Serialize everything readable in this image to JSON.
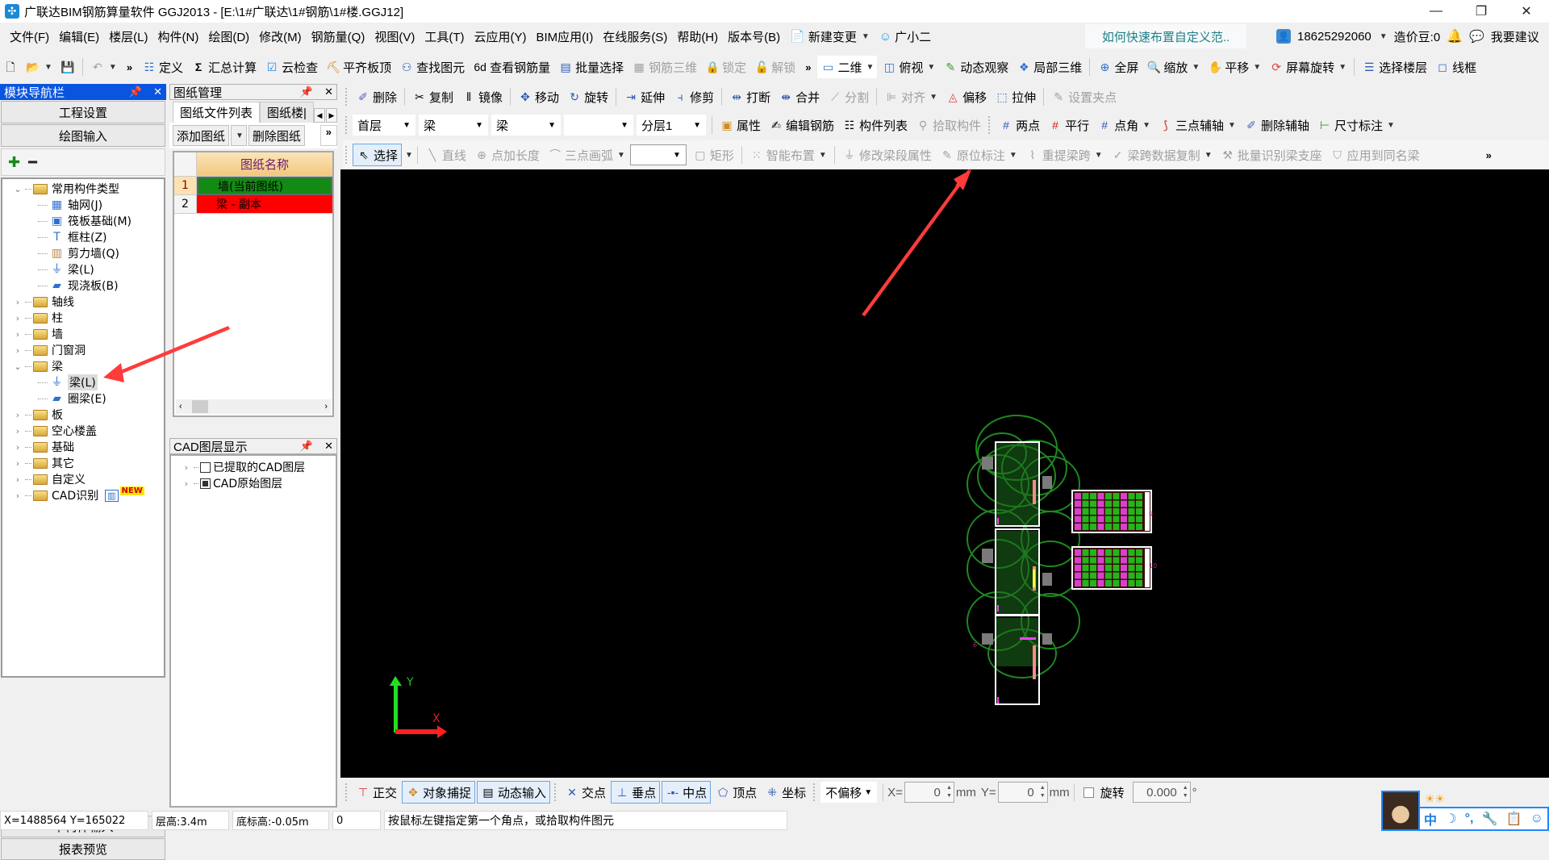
{
  "window": {
    "title": "广联达BIM钢筋算量软件 GGJ2013 - [E:\\1#广联达\\1#钢筋\\1#楼.GGJ12]",
    "controls": {
      "minimize": "—",
      "restore": "❐",
      "close": "✕"
    }
  },
  "menu": {
    "items": [
      "文件(F)",
      "编辑(E)",
      "楼层(L)",
      "构件(N)",
      "绘图(D)",
      "修改(M)",
      "钢筋量(Q)",
      "视图(V)",
      "工具(T)",
      "云应用(Y)",
      "BIM应用(I)",
      "在线服务(S)",
      "帮助(H)",
      "版本号(B)"
    ],
    "new_change": "新建变更",
    "assistant": "广小二",
    "tip": "如何快速布置自定义范..",
    "account": "18625292060",
    "beans": "造价豆:0",
    "suggest": "我要建议"
  },
  "toolbar1": {
    "items": [
      {
        "label": "定义",
        "icon": "define-icon",
        "disabled": false
      },
      {
        "label": "汇总计算",
        "icon": "sigma-icon",
        "disabled": false
      },
      {
        "label": "云检查",
        "icon": "cloud-check-icon",
        "disabled": false
      },
      {
        "label": "平齐板顶",
        "icon": "align-slab-top-icon",
        "disabled": false
      },
      {
        "label": "查找图元",
        "icon": "binoculars-icon",
        "disabled": false
      },
      {
        "label": "查看钢筋量",
        "icon": "view-rebar-icon",
        "disabled": false
      },
      {
        "label": "批量选择",
        "icon": "batch-select-icon",
        "disabled": false
      },
      {
        "label": "钢筋三维",
        "icon": "rebar-3d-icon",
        "disabled": true
      },
      {
        "label": "锁定",
        "icon": "lock-icon",
        "disabled": true
      },
      {
        "label": "解锁",
        "icon": "unlock-icon",
        "disabled": true
      }
    ],
    "view_items": [
      {
        "label": "二维",
        "icon": "2d-icon",
        "dropdown": true
      },
      {
        "label": "俯视",
        "icon": "top-view-icon",
        "dropdown": true
      },
      {
        "label": "动态观察",
        "icon": "orbit-icon",
        "dropdown": false
      },
      {
        "label": "局部三维",
        "icon": "local-3d-icon",
        "dropdown": false
      },
      {
        "label": "全屏",
        "icon": "fullscreen-icon",
        "dropdown": false
      },
      {
        "label": "缩放",
        "icon": "zoom-icon",
        "dropdown": true
      },
      {
        "label": "平移",
        "icon": "pan-icon",
        "dropdown": true
      },
      {
        "label": "屏幕旋转",
        "icon": "screen-rotate-icon",
        "dropdown": true
      },
      {
        "label": "选择楼层",
        "icon": "select-floor-icon",
        "dropdown": false
      },
      {
        "label": "线框",
        "icon": "wireframe-icon",
        "dropdown": false
      }
    ]
  },
  "toolbar2": {
    "items": [
      {
        "label": "删除",
        "icon": "delete-icon",
        "disabled": false
      },
      {
        "label": "复制",
        "icon": "copy-icon",
        "disabled": false
      },
      {
        "label": "镜像",
        "icon": "mirror-icon",
        "disabled": false
      },
      {
        "label": "移动",
        "icon": "move-icon",
        "disabled": false
      },
      {
        "label": "旋转",
        "icon": "rotate-icon",
        "disabled": false
      },
      {
        "label": "延伸",
        "icon": "extend-icon",
        "disabled": false
      },
      {
        "label": "修剪",
        "icon": "trim-icon",
        "disabled": false
      },
      {
        "label": "打断",
        "icon": "break-icon",
        "disabled": false
      },
      {
        "label": "合并",
        "icon": "merge-icon",
        "disabled": false
      },
      {
        "label": "分割",
        "icon": "split-icon",
        "disabled": true
      },
      {
        "label": "对齐",
        "icon": "align-icon",
        "disabled": true
      },
      {
        "label": "偏移",
        "icon": "offset-icon",
        "disabled": false
      },
      {
        "label": "拉伸",
        "icon": "stretch-icon",
        "disabled": false
      },
      {
        "label": "设置夹点",
        "icon": "grip-point-icon",
        "disabled": true
      }
    ]
  },
  "toolbar3": {
    "floor": "首层",
    "type": "梁",
    "subtype": "梁",
    "component": "",
    "layer": "分层1",
    "items": [
      {
        "label": "属性",
        "icon": "properties-icon",
        "disabled": false
      },
      {
        "label": "编辑钢筋",
        "icon": "edit-rebar-icon",
        "disabled": false
      },
      {
        "label": "构件列表",
        "icon": "component-list-icon",
        "disabled": false
      },
      {
        "label": "拾取构件",
        "icon": "pick-component-icon",
        "disabled": true
      }
    ],
    "axis_items": [
      {
        "label": "两点",
        "icon": "two-point-axis-icon",
        "dropdown": false
      },
      {
        "label": "平行",
        "icon": "parallel-axis-icon",
        "dropdown": false
      },
      {
        "label": "点角",
        "icon": "point-angle-axis-icon",
        "dropdown": true
      },
      {
        "label": "三点辅轴",
        "icon": "three-point-axis-icon",
        "dropdown": true
      },
      {
        "label": "删除辅轴",
        "icon": "delete-axis-icon",
        "dropdown": false
      },
      {
        "label": "尺寸标注",
        "icon": "dimension-icon",
        "dropdown": true
      }
    ]
  },
  "toolbar4": {
    "select": "选择",
    "items": [
      {
        "label": "直线",
        "icon": "line-icon",
        "disabled": true
      },
      {
        "label": "点加长度",
        "icon": "point-length-icon",
        "disabled": true
      },
      {
        "label": "三点画弧",
        "icon": "arc-icon",
        "disabled": true
      }
    ],
    "arc_combo": "",
    "rect": "矩形",
    "more_items": [
      {
        "label": "智能布置",
        "icon": "smart-place-icon",
        "dropdown": true
      },
      {
        "label": "修改梁段属性",
        "icon": "beam-segment-icon",
        "dropdown": false
      },
      {
        "label": "原位标注",
        "icon": "in-situ-label-icon",
        "dropdown": true
      },
      {
        "label": "重提梁跨",
        "icon": "re-extract-span-icon",
        "dropdown": true
      },
      {
        "label": "梁跨数据复制",
        "icon": "span-copy-icon",
        "dropdown": true
      },
      {
        "label": "批量识别梁支座",
        "icon": "batch-support-icon",
        "dropdown": false
      },
      {
        "label": "应用到同名梁",
        "icon": "apply-same-beam-icon",
        "dropdown": false
      }
    ]
  },
  "leftnav": {
    "title": "模块导航栏",
    "top_buttons": [
      "工程设置",
      "绘图输入"
    ],
    "tree": [
      {
        "label": "常用构件类型",
        "expanded": true,
        "children": [
          {
            "label": "轴网(J)",
            "icon": "grid-icon"
          },
          {
            "label": "筏板基础(M)",
            "icon": "raft-foundation-icon"
          },
          {
            "label": "框柱(Z)",
            "icon": "frame-column-icon"
          },
          {
            "label": "剪力墙(Q)",
            "icon": "shear-wall-icon"
          },
          {
            "label": "梁(L)",
            "icon": "beam-icon"
          },
          {
            "label": "现浇板(B)",
            "icon": "slab-icon"
          }
        ]
      },
      {
        "label": "轴线",
        "expanded": false
      },
      {
        "label": "柱",
        "expanded": false
      },
      {
        "label": "墙",
        "expanded": false
      },
      {
        "label": "门窗洞",
        "expanded": false
      },
      {
        "label": "梁",
        "expanded": true,
        "children": [
          {
            "label": "梁(L)",
            "icon": "beam-icon",
            "selected": true
          },
          {
            "label": "圈梁(E)",
            "icon": "ring-beam-icon"
          }
        ]
      },
      {
        "label": "板",
        "expanded": false
      },
      {
        "label": "空心楼盖",
        "expanded": false
      },
      {
        "label": "基础",
        "expanded": false
      },
      {
        "label": "其它",
        "expanded": false
      },
      {
        "label": "自定义",
        "expanded": false
      },
      {
        "label": "CAD识别",
        "expanded": false,
        "badge": "NEW"
      }
    ],
    "bottom_buttons": [
      "单构件输入",
      "报表预览"
    ]
  },
  "drawing_manager": {
    "title": "图纸管理",
    "tabs": [
      "图纸文件列表",
      "图纸楼|"
    ],
    "add_button": "添加图纸",
    "delete_button": "删除图纸",
    "column_header": "图纸名称",
    "rows": [
      {
        "num": "1",
        "name": "墙(当前图纸)",
        "color": "#138a13"
      },
      {
        "num": "2",
        "name": "梁 - 副本",
        "color": "#ff0000"
      }
    ]
  },
  "cad_layers": {
    "title": "CAD图层显示",
    "items": [
      {
        "label": "已提取的CAD图层",
        "checked": false
      },
      {
        "label": "CAD原始图层",
        "checked": true
      }
    ]
  },
  "canvas": {
    "background": "#000000",
    "axis_y": "Y",
    "axis_x": "X",
    "sheet_labels": [
      "9",
      "10",
      "6"
    ]
  },
  "snapbar": {
    "items": [
      {
        "label": "正交",
        "icon": "ortho-icon",
        "on": false
      },
      {
        "label": "对象捕捉",
        "icon": "object-snap-icon",
        "on": true
      },
      {
        "label": "动态输入",
        "icon": "dynamic-input-icon",
        "on": true
      },
      {
        "label": "交点",
        "icon": "intersection-icon",
        "on": false
      },
      {
        "label": "垂点",
        "icon": "perpendicular-icon",
        "on": true
      },
      {
        "label": "中点",
        "icon": "midpoint-icon",
        "on": true
      },
      {
        "label": "顶点",
        "icon": "vertex-icon",
        "on": false
      },
      {
        "label": "坐标",
        "icon": "coordinate-icon",
        "on": false
      }
    ],
    "offset_mode": "不偏移",
    "x_label": "X=",
    "x_value": "0",
    "y_label": "Y=",
    "y_value": "0",
    "unit": "mm",
    "rotate_label": "旋转",
    "rotate_value": "0.000",
    "degree": "°"
  },
  "statusbar": {
    "coords": "X=1488564 Y=165022",
    "floor_height": "层高:3.4m",
    "base_elev": "底标高:-0.05m",
    "count": "0",
    "hint": "按鼠标左键指定第一个角点，或拾取构件图元"
  },
  "ime": {
    "items": [
      "中",
      "☽",
      "°,",
      "🔧",
      "📋",
      "☺"
    ]
  }
}
